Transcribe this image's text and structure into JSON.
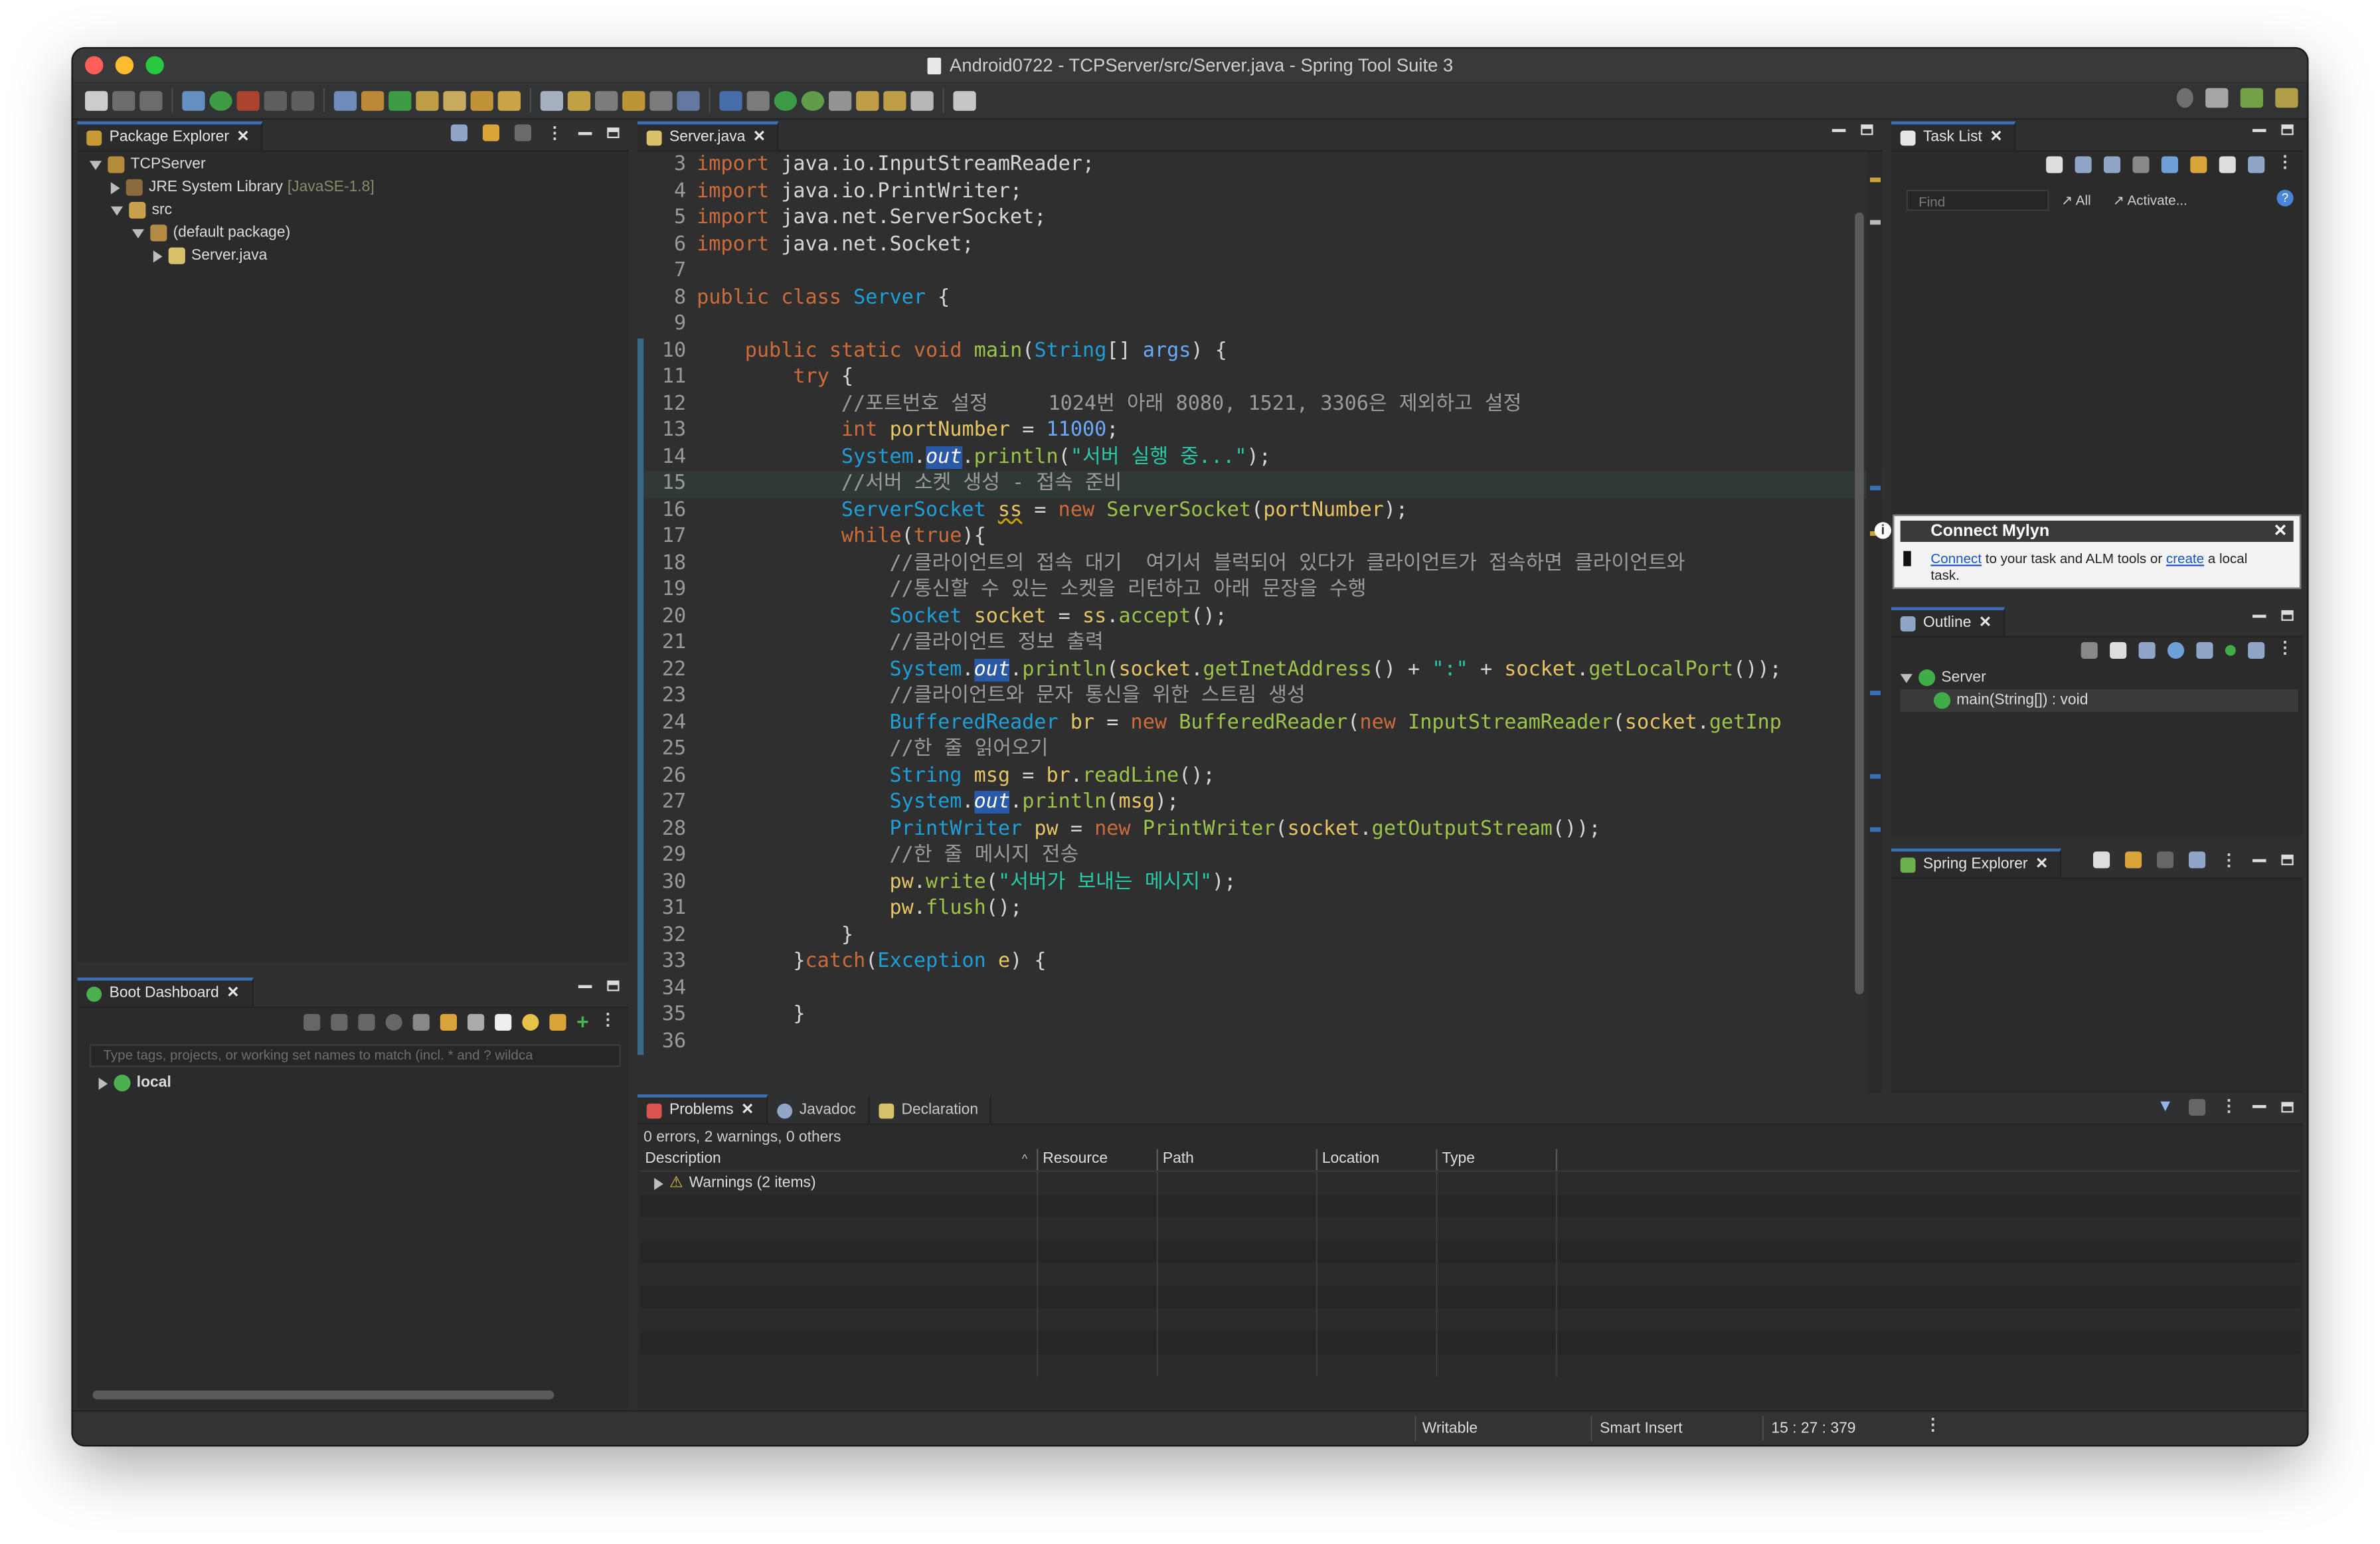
{
  "window": {
    "title": "Android0722 - TCPServer/src/Server.java - Spring Tool Suite 3"
  },
  "package_explorer": {
    "tab_label": "Package Explorer",
    "tree": [
      {
        "label": "TCPServer",
        "extra": ""
      },
      {
        "label": "JRE System Library",
        "extra": "[JavaSE-1.8]"
      },
      {
        "label": "src",
        "extra": ""
      },
      {
        "label": "(default package)",
        "extra": ""
      },
      {
        "label": "Server.java",
        "extra": ""
      }
    ]
  },
  "boot_dashboard": {
    "tab_label": "Boot Dashboard",
    "filter_placeholder": "Type tags, projects, or working set names to match (incl. * and ? wildca",
    "items": [
      {
        "label": "local"
      }
    ]
  },
  "editor": {
    "tab_label": "Server.java",
    "lines": [
      {
        "n": "3"
      },
      {
        "n": "4"
      },
      {
        "n": "5"
      },
      {
        "n": "6"
      },
      {
        "n": "7"
      },
      {
        "n": "8"
      },
      {
        "n": "9"
      },
      {
        "n": "10"
      },
      {
        "n": "11"
      },
      {
        "n": "12"
      },
      {
        "n": "13"
      },
      {
        "n": "14"
      },
      {
        "n": "15"
      },
      {
        "n": "16"
      },
      {
        "n": "17"
      },
      {
        "n": "18"
      },
      {
        "n": "19"
      },
      {
        "n": "20"
      },
      {
        "n": "21"
      },
      {
        "n": "22"
      },
      {
        "n": "23"
      },
      {
        "n": "24"
      },
      {
        "n": "25"
      },
      {
        "n": "26"
      },
      {
        "n": "27"
      },
      {
        "n": "28"
      },
      {
        "n": "29"
      },
      {
        "n": "30"
      },
      {
        "n": "31"
      },
      {
        "n": "32"
      },
      {
        "n": "33"
      },
      {
        "n": "34"
      },
      {
        "n": "35"
      },
      {
        "n": "36"
      }
    ],
    "tokens": {
      "import": "import",
      "imp1": "java.io.InputStreamReader;",
      "imp2": "java.io.PrintWriter;",
      "imp3": "java.net.ServerSocket;",
      "imp4": "java.net.Socket;",
      "public": "public",
      "class": "class",
      "Server": "Server",
      "brace_open": " {",
      "static": "static",
      "void": "void",
      "main": "main",
      "String": "String",
      "args": "args",
      "try": "try",
      "c12": "//포트번호 설정     1024번 아래 8080, 1521, 3306은 제외하고 설정",
      "int": "int",
      "portNumber": "portNumber",
      "num11000": "11000",
      "System": "System",
      "out": "out",
      "println": "println",
      "s14": "\"서버 실행 중...\"",
      "c15": "//서버 소켓 생성 - 접속 준비",
      "ServerSocket": "ServerSocket",
      "ss": "ss",
      "new": "new",
      "while": "while",
      "true": "true",
      "c18": "//클라이언트의 접속 대기  여기서 블럭되어 있다가 클라이언트가 접속하면 클라이언트와",
      "c19": "//통신할 수 있는 소켓을 리턴하고 아래 문장을 수행",
      "Socket": "Socket",
      "socket": "socket",
      "accept": "accept",
      "c21": "//클라이언트 정보 출력",
      "getInetAddress": "getInetAddress",
      "colon_str": "\":\"",
      "getLocalPort": "getLocalPort",
      "c23": "//클라이언트와 문자 통신을 위한 스트림 생성",
      "BufferedReader": "BufferedReader",
      "br": "br",
      "InputStreamReader": "InputStreamReader",
      "getInp": "getInp",
      "c25": "//한 줄 읽어오기",
      "msg": "msg",
      "readLine": "readLine",
      "PrintWriter": "PrintWriter",
      "pw": "pw",
      "getOutputStream": "getOutputStream",
      "c29": "//한 줄 메시지 전송",
      "write": "write",
      "s30": "\"서버가 보내는 메시지\"",
      "flush": "flush",
      "catch": "catch",
      "Exception": "Exception",
      "e": "e"
    }
  },
  "task_list": {
    "tab_label": "Task List",
    "find_placeholder": "Find",
    "all_label": "All",
    "activate_label": "Activate..."
  },
  "mylyn": {
    "title": "Connect Mylyn",
    "link1": "Connect",
    "text1": " to your task and ALM tools or ",
    "link2": "create",
    "text2": " a local task."
  },
  "outline": {
    "tab_label": "Outline",
    "items": [
      {
        "label": "Server"
      },
      {
        "label": "main(String[]) : void"
      }
    ]
  },
  "spring_explorer": {
    "tab_label": "Spring Explorer"
  },
  "problems": {
    "tabs": [
      {
        "label": "Problems"
      },
      {
        "label": "Javadoc"
      },
      {
        "label": "Declaration"
      }
    ],
    "summary": "0 errors, 2 warnings, 0 others",
    "columns": [
      "Description",
      "Resource",
      "Path",
      "Location",
      "Type"
    ],
    "rows": [
      {
        "description": "Warnings (2 items)"
      }
    ]
  },
  "statusbar": {
    "writable": "Writable",
    "insert_mode": "Smart Insert",
    "position": "15 : 27 : 379"
  },
  "colors": {
    "keyword": "#cc6c3a",
    "type": "#1e9fd7",
    "variable": "#e6c565",
    "method": "#9ec34a",
    "string": "#28c9a7",
    "comment": "#9b9b9b",
    "active_tab": "#3b6fb6"
  }
}
